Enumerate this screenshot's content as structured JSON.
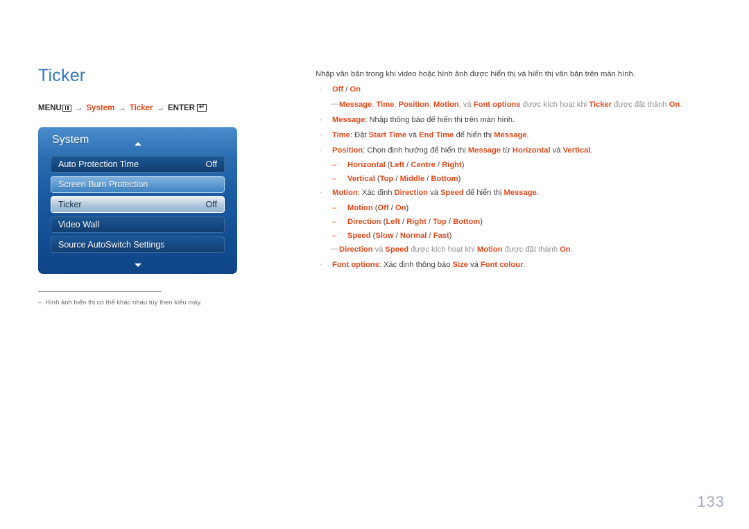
{
  "page": {
    "title": "Ticker",
    "number": "133"
  },
  "breadcrumb": {
    "menu_label": "MENU",
    "menu_icon": "menu-grid-icon",
    "system_label": "System",
    "ticker_label": "Ticker",
    "enter_label": "ENTER",
    "enter_icon": "enter-return-icon",
    "arrow": "→"
  },
  "osd": {
    "title": "System",
    "scroll_up_icon": "triangle-up-icon",
    "scroll_down_icon": "triangle-down-icon",
    "rows": [
      {
        "label": "Auto Protection Time",
        "value": "Off",
        "state": "normal"
      },
      {
        "label": "Screen Burn Protection",
        "value": "",
        "state": "focused"
      },
      {
        "label": "Ticker",
        "value": "Off",
        "state": "selected"
      },
      {
        "label": "Video Wall",
        "value": "",
        "state": "normal"
      },
      {
        "label": "Source AutoSwitch Settings",
        "value": "",
        "state": "normal"
      }
    ]
  },
  "footnote": {
    "dash": "–",
    "text": "Hình ảnh hiển thị có thể khác nhau tùy theo kiểu máy."
  },
  "content": {
    "intro": "Nhập văn bản trong khi video hoặc hình ảnh được hiển thị và hiển thị văn bản trên màn hình.",
    "bullet_marker": "·",
    "sub_marker": "–",
    "note_marker": "—",
    "items": [
      {
        "id": "off-on",
        "parts": [
          {
            "t": "Off",
            "k": true
          },
          {
            "t": " / ",
            "k": false
          },
          {
            "t": "On",
            "k": true
          }
        ]
      },
      {
        "id": "message",
        "parts": [
          {
            "t": "Message",
            "k": true
          },
          {
            "t": ": Nhập thông báo để hiển thị trên màn hình.",
            "k": false
          }
        ]
      },
      {
        "id": "time",
        "parts": [
          {
            "t": "Time",
            "k": true
          },
          {
            "t": ": Đặt ",
            "k": false
          },
          {
            "t": "Start Time",
            "k": true
          },
          {
            "t": " và ",
            "k": false
          },
          {
            "t": "End Time",
            "k": true
          },
          {
            "t": " để hiển thị ",
            "k": false
          },
          {
            "t": "Message",
            "k": true
          },
          {
            "t": ".",
            "k": false
          }
        ]
      },
      {
        "id": "position",
        "parts": [
          {
            "t": "Position",
            "k": true
          },
          {
            "t": ": Chọn định hướng để hiển thị ",
            "k": false
          },
          {
            "t": "Message",
            "k": true
          },
          {
            "t": " từ ",
            "k": false
          },
          {
            "t": "Horizontal",
            "k": true
          },
          {
            "t": " và ",
            "k": false
          },
          {
            "t": "Vertical",
            "k": true
          },
          {
            "t": ".",
            "k": false
          }
        ]
      },
      {
        "id": "motion",
        "parts": [
          {
            "t": "Motion",
            "k": true
          },
          {
            "t": ": Xác định ",
            "k": false
          },
          {
            "t": "Direction",
            "k": true
          },
          {
            "t": " và ",
            "k": false
          },
          {
            "t": "Speed",
            "k": true
          },
          {
            "t": " để hiển thị ",
            "k": false
          },
          {
            "t": "Message",
            "k": true
          },
          {
            "t": ".",
            "k": false
          }
        ]
      },
      {
        "id": "font-options",
        "parts": [
          {
            "t": "Font options",
            "k": true
          },
          {
            "t": ": Xác định thông báo ",
            "k": false
          },
          {
            "t": "Size",
            "k": true
          },
          {
            "t": " và ",
            "k": false
          },
          {
            "t": "Font colour",
            "k": true
          },
          {
            "t": ".",
            "k": false
          }
        ]
      }
    ],
    "note_ticker": {
      "parts": [
        {
          "t": "Message",
          "k": true
        },
        {
          "t": ", ",
          "k": false
        },
        {
          "t": "Time",
          "k": true
        },
        {
          "t": ", ",
          "k": false
        },
        {
          "t": "Position",
          "k": true
        },
        {
          "t": ", ",
          "k": false
        },
        {
          "t": "Motion",
          "k": true
        },
        {
          "t": ", và ",
          "k": false
        },
        {
          "t": "Font options",
          "k": true
        },
        {
          "t": " được kích hoạt khi ",
          "k": false
        },
        {
          "t": "Ticker",
          "k": true
        },
        {
          "t": " được đặt thành ",
          "k": false
        },
        {
          "t": "On",
          "k": true
        },
        {
          "t": ".",
          "k": false
        }
      ]
    },
    "note_motion": {
      "parts": [
        {
          "t": "Direction",
          "k": true
        },
        {
          "t": " và ",
          "k": false
        },
        {
          "t": "Speed",
          "k": true
        },
        {
          "t": " được kích hoạt khi ",
          "k": false
        },
        {
          "t": "Motion",
          "k": true
        },
        {
          "t": " được đặt thành ",
          "k": false
        },
        {
          "t": "On",
          "k": true
        },
        {
          "t": ".",
          "k": false
        }
      ]
    },
    "sub_position": [
      {
        "id": "horizontal",
        "parts": [
          {
            "t": "Horizontal",
            "k": true
          },
          {
            "t": " (",
            "k": false
          },
          {
            "t": "Left",
            "k": true
          },
          {
            "t": " / ",
            "k": false
          },
          {
            "t": "Centre",
            "k": true
          },
          {
            "t": " / ",
            "k": false
          },
          {
            "t": "Right",
            "k": true
          },
          {
            "t": ")",
            "k": false
          }
        ]
      },
      {
        "id": "vertical",
        "parts": [
          {
            "t": "Vertical",
            "k": true
          },
          {
            "t": " (",
            "k": false
          },
          {
            "t": "Top",
            "k": true
          },
          {
            "t": " / ",
            "k": false
          },
          {
            "t": "Middle",
            "k": true
          },
          {
            "t": " / ",
            "k": false
          },
          {
            "t": "Bottom",
            "k": true
          },
          {
            "t": ")",
            "k": false
          }
        ]
      }
    ],
    "sub_motion": [
      {
        "id": "motion-sub",
        "parts": [
          {
            "t": "Motion",
            "k": true
          },
          {
            "t": " (",
            "k": false
          },
          {
            "t": "Off",
            "k": true
          },
          {
            "t": " / ",
            "k": false
          },
          {
            "t": "On",
            "k": true
          },
          {
            "t": ")",
            "k": false
          }
        ]
      },
      {
        "id": "direction-sub",
        "parts": [
          {
            "t": "Direction",
            "k": true
          },
          {
            "t": " (",
            "k": false
          },
          {
            "t": "Left",
            "k": true
          },
          {
            "t": " / ",
            "k": false
          },
          {
            "t": "Right",
            "k": true
          },
          {
            "t": " / ",
            "k": false
          },
          {
            "t": "Top",
            "k": true
          },
          {
            "t": " / ",
            "k": false
          },
          {
            "t": "Bottom",
            "k": true
          },
          {
            "t": ")",
            "k": false
          }
        ]
      },
      {
        "id": "speed-sub",
        "parts": [
          {
            "t": "Speed",
            "k": true
          },
          {
            "t": " (",
            "k": false
          },
          {
            "t": "Slow",
            "k": true
          },
          {
            "t": " / ",
            "k": false
          },
          {
            "t": "Normal",
            "k": true
          },
          {
            "t": " / ",
            "k": false
          },
          {
            "t": "Fast",
            "k": true
          },
          {
            "t": ")",
            "k": false
          }
        ]
      }
    ]
  },
  "colors": {
    "heading_blue": "#2f78bd",
    "keyword_orange": "#e0491c",
    "body_gray": "#3f3f44",
    "note_gray": "#8e8e94",
    "page_number": "#a9abc4"
  }
}
